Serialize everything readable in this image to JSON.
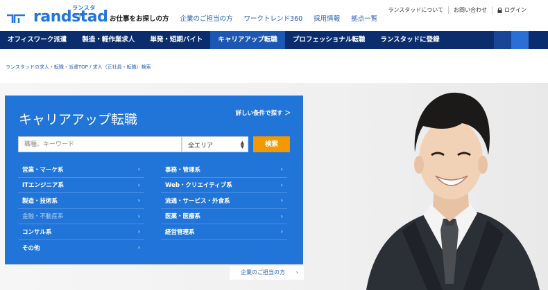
{
  "logo": {
    "kana": "ランスタッド",
    "word": "randstad"
  },
  "main_nav": [
    {
      "label": "お仕事をお探しの方",
      "active": true
    },
    {
      "label": "企業のご担当の方",
      "active": false
    },
    {
      "label": "ワークトレンド360",
      "active": false
    },
    {
      "label": "採用情報",
      "active": false
    },
    {
      "label": "拠点一覧",
      "active": false
    }
  ],
  "util_nav": [
    {
      "label": "ランスタッドについて"
    },
    {
      "label": "お問い合わせ"
    },
    {
      "label": "ログイン",
      "icon": "lock-icon"
    }
  ],
  "category_nav": [
    {
      "label": "オフィスワーク派遣",
      "active": false
    },
    {
      "label": "製造・軽作業求人",
      "active": false
    },
    {
      "label": "単発・短期バイト",
      "active": false
    },
    {
      "label": "キャリアアップ転職",
      "active": true
    },
    {
      "label": "プロフェッショナル転職",
      "active": false
    },
    {
      "label": "ランスタッドに登録",
      "active": false
    }
  ],
  "breadcrumb": "ランスタッドの求人・転職・派遣TOP / 求人（正社員・転職）検索",
  "panel": {
    "title": "キャリアアップ転職",
    "detail_link": "詳しい条件で探す ＞",
    "search_placeholder": "職種、キーワード",
    "area_value": "全エリア",
    "search_button": "検索",
    "left_categories": [
      {
        "label": "営業・マーケ系",
        "dim": false
      },
      {
        "label": "ITエンジニア系",
        "dim": false
      },
      {
        "label": "製造・技術系",
        "dim": false
      },
      {
        "label": "金融・不動産系",
        "dim": true
      },
      {
        "label": "コンサル系",
        "dim": false
      },
      {
        "label": "その他",
        "dim": false
      }
    ],
    "right_categories": [
      {
        "label": "事務・管理系",
        "dim": false
      },
      {
        "label": "Web・クリエイティブ系",
        "dim": false
      },
      {
        "label": "流通・サービス・外食系",
        "dim": false
      },
      {
        "label": "医薬・医療系",
        "dim": false
      },
      {
        "label": "経営管理系",
        "dim": false
      }
    ]
  },
  "corporate_link": "企業のご担当の方",
  "chevron": "›",
  "colors": {
    "brand_blue": "#2175d9",
    "nav_dark": "#0b2d6e",
    "nav_active": "#1b57b3",
    "accent_orange": "#f39800"
  }
}
